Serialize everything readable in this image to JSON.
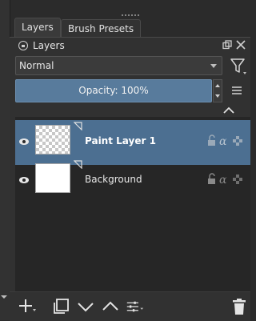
{
  "tabs": [
    {
      "label": "Layers",
      "active": true
    },
    {
      "label": "Brush Presets",
      "active": false
    }
  ],
  "panel": {
    "title": "Layers",
    "blend_mode": "Normal",
    "opacity_label": "Opacity:  100%"
  },
  "layers": [
    {
      "name": "Paint Layer 1",
      "selected": true,
      "thumbnail": "transparent-checker"
    },
    {
      "name": "Background",
      "selected": false,
      "thumbnail": "white"
    }
  ],
  "icons": {
    "dock": [
      "float-icon",
      "close-icon"
    ],
    "toolbar": [
      "add-icon",
      "duplicate-icon",
      "move-down-icon",
      "move-up-icon",
      "properties-icon",
      "delete-icon"
    ]
  },
  "colors": {
    "accent": "#587b9c",
    "selection": "#4c6f91",
    "background": "#2b2b2b"
  }
}
